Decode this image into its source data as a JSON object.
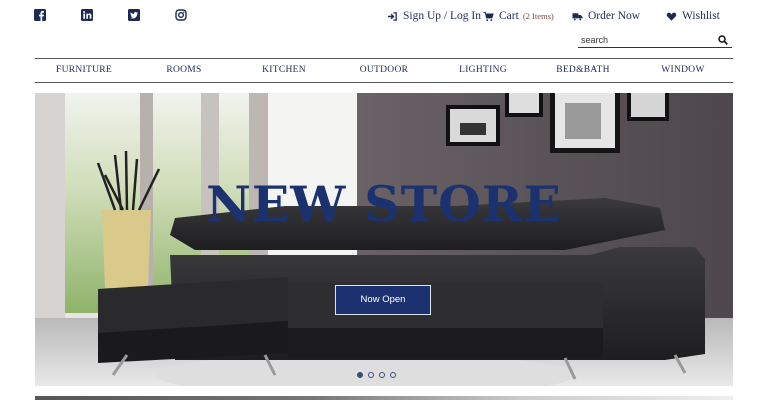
{
  "social": [
    {
      "name": "facebook-icon"
    },
    {
      "name": "linkedin-icon"
    },
    {
      "name": "twitter-icon"
    },
    {
      "name": "instagram-icon"
    }
  ],
  "header": {
    "sign_in": "Sign Up / Log In",
    "cart": "Cart",
    "cart_count": "(2 Items)",
    "order": "Order Now",
    "wishlist": "Wishlist"
  },
  "search": {
    "placeholder": "search"
  },
  "nav": [
    "FURNITURE",
    "ROOMS",
    "KITCHEN",
    "OUTDOOR",
    "LIGHTING",
    "BED&BATH",
    "WINDOW"
  ],
  "hero": {
    "title": "NEW STORE",
    "button": "Now Open",
    "slides": 4,
    "active_slide": 1
  },
  "colors": {
    "brand": "#1b3170",
    "text": "#1d2a57"
  }
}
